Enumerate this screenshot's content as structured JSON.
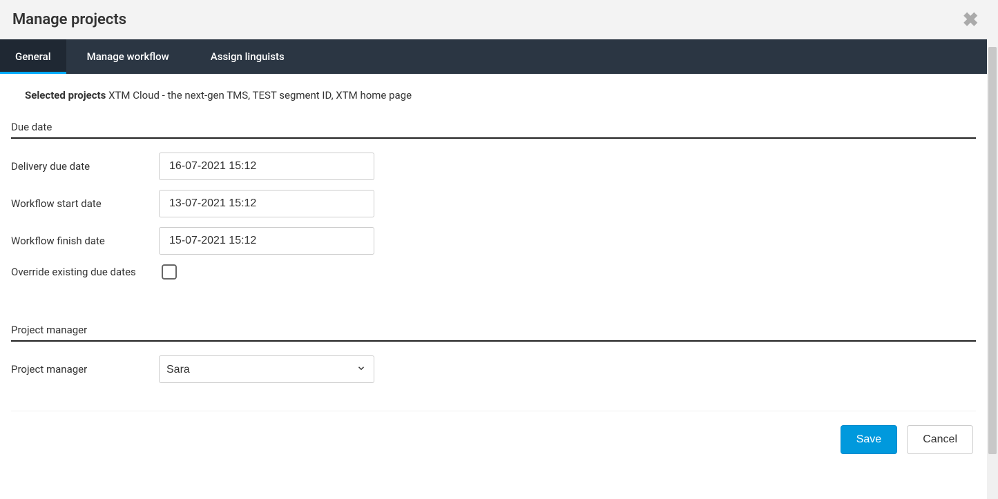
{
  "header": {
    "title": "Manage projects"
  },
  "tabs": [
    {
      "label": "General",
      "active": true
    },
    {
      "label": "Manage workflow",
      "active": false
    },
    {
      "label": "Assign linguists",
      "active": false
    }
  ],
  "selected": {
    "label": "Selected projects",
    "value": "XTM Cloud - the next-gen TMS, TEST segment ID, XTM home page"
  },
  "sections": {
    "due_date": {
      "title": "Due date",
      "fields": {
        "delivery_due_date": {
          "label": "Delivery due date",
          "value": "16-07-2021 15:12"
        },
        "workflow_start_date": {
          "label": "Workflow start date",
          "value": "13-07-2021 15:12"
        },
        "workflow_finish_date": {
          "label": "Workflow finish date",
          "value": "15-07-2021 15:12"
        },
        "override": {
          "label": "Override existing due dates",
          "checked": false
        }
      }
    },
    "project_manager": {
      "title": "Project manager",
      "fields": {
        "pm": {
          "label": "Project manager",
          "value": "Sara"
        }
      }
    }
  },
  "footer": {
    "save": "Save",
    "cancel": "Cancel"
  }
}
